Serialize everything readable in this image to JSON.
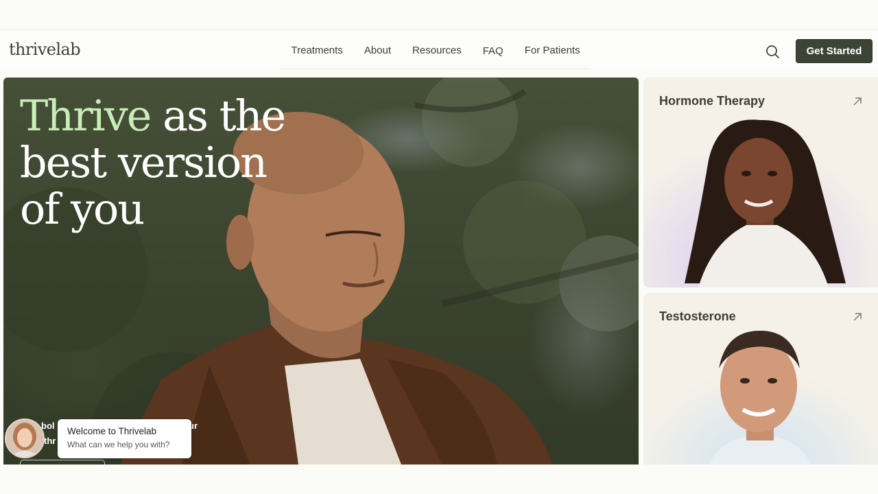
{
  "brand": {
    "logo": "thrivelab"
  },
  "nav": {
    "items": [
      "Treatments",
      "About",
      "Resources",
      "FAQ",
      "For Patients"
    ],
    "cta_label": "Get Started"
  },
  "hero": {
    "headline_accent": "Thrive",
    "headline_line1_rest": " as the",
    "headline_line2": "best version",
    "headline_line3": "of you",
    "partial_text_1": "bol",
    "partial_text_2": "ur",
    "partial_text_3": "thr"
  },
  "chat": {
    "title": "Welcome to Thrivelab",
    "subtitle": "What can we help you with?"
  },
  "cards": [
    {
      "title": "Hormone Therapy"
    },
    {
      "title": "Testosterone"
    }
  ],
  "colors": {
    "accent_green": "#c9edb7",
    "cta_bg": "#3e4435",
    "card_bg": "#f5f1e8",
    "text_dark": "#3b3e35"
  },
  "icons": {
    "search": "search-icon",
    "card_arrow": "arrow-up-right-icon",
    "chat_avatar": "assistant-avatar"
  }
}
